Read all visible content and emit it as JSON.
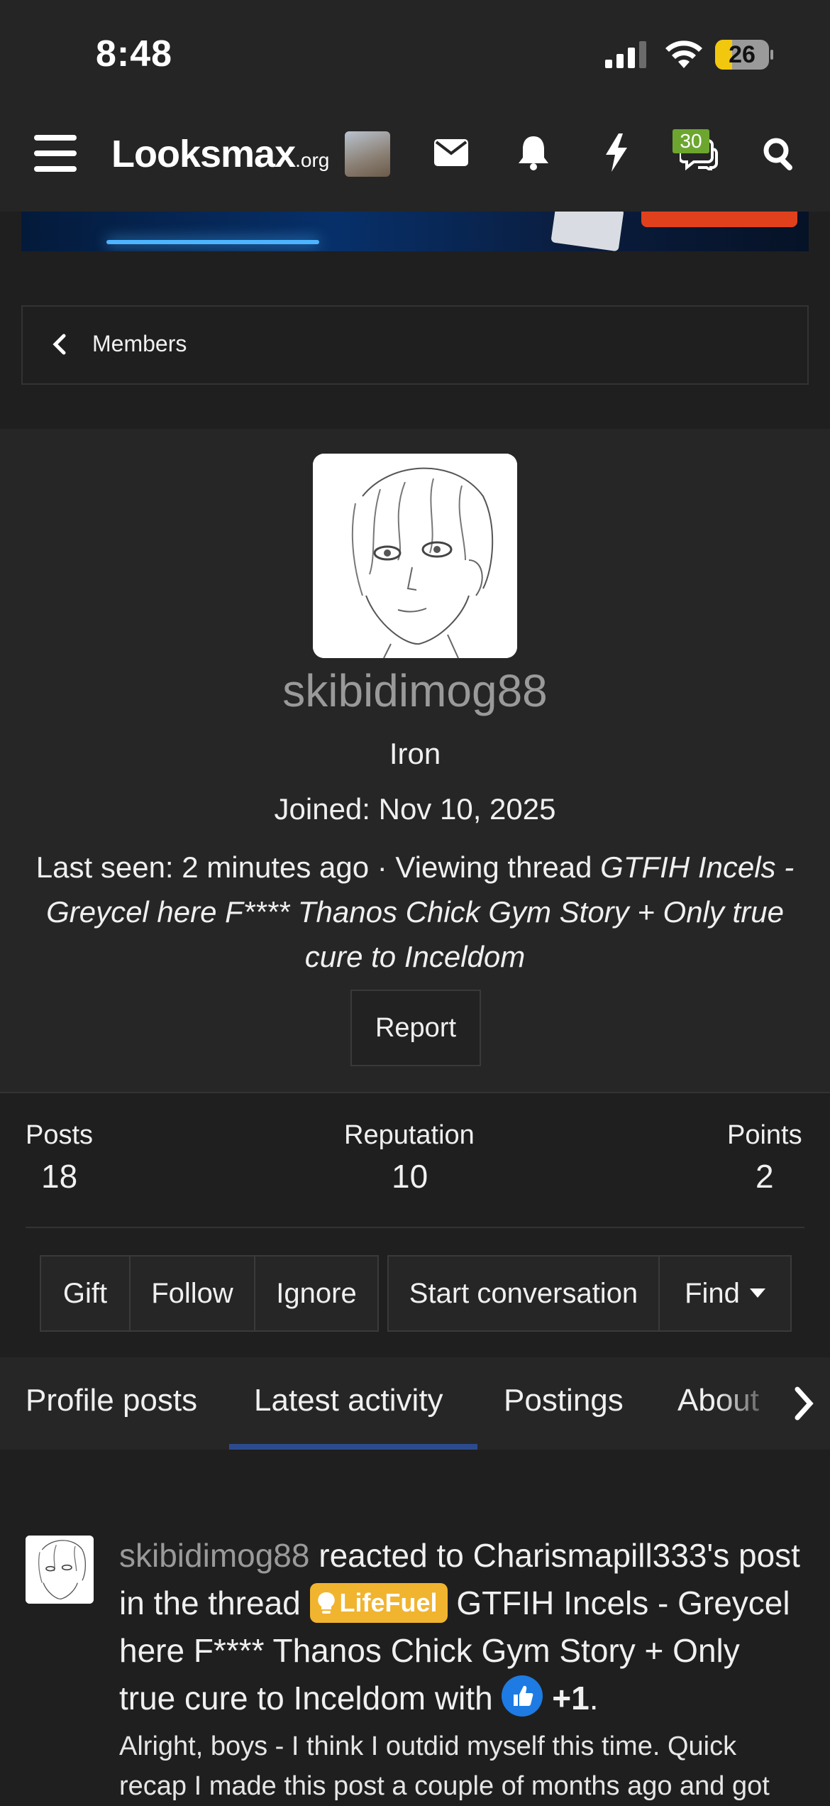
{
  "status_bar": {
    "time": "8:48",
    "battery": "26"
  },
  "nav": {
    "logo_main": "Looksmax",
    "logo_suffix": ".org",
    "chat_badge": "30"
  },
  "breadcrumb": {
    "label": "Members"
  },
  "profile": {
    "username": "skibidimog88",
    "rank": "Iron",
    "joined": "Joined: Nov 10, 2025",
    "last_seen_prefix": "Last seen: 2 minutes ago · Viewing thread ",
    "last_seen_thread": "GTFIH Incels - Greycel here F**** Thanos Chick Gym Story + Only true cure to Inceldom",
    "report_label": "Report"
  },
  "stats": [
    {
      "label": "Posts",
      "value": "18"
    },
    {
      "label": "Reputation",
      "value": "10"
    },
    {
      "label": "Points",
      "value": "2"
    }
  ],
  "actions": {
    "gift": "Gift",
    "follow": "Follow",
    "ignore": "Ignore",
    "start_conversation": "Start conversation",
    "find": "Find"
  },
  "tabs": [
    {
      "label": "Profile posts",
      "active": false
    },
    {
      "label": "Latest activity",
      "active": true
    },
    {
      "label": "Postings",
      "active": false
    },
    {
      "label": "About",
      "active": false
    }
  ],
  "activity": {
    "username": "skibidimog88",
    "text_1": " reacted to Charismapill333's post in the thread ",
    "prefix_label": "LifeFuel",
    "thread_title": " GTFIH Incels - Greycel here F**** Thanos Chick Gym Story + Only true cure to Inceldom with ",
    "reaction": "+1",
    "period": ".",
    "snippet": "Alright, boys - I think I outdid myself this time. Quick recap I made this post a couple of months ago and got"
  },
  "colors": {
    "background": "#1f1f1f",
    "panel": "#262626",
    "active_tab": "#2c4b8f",
    "lifefuel_prefix": "#f1b42f",
    "chat_badge": "#6ca62f"
  }
}
